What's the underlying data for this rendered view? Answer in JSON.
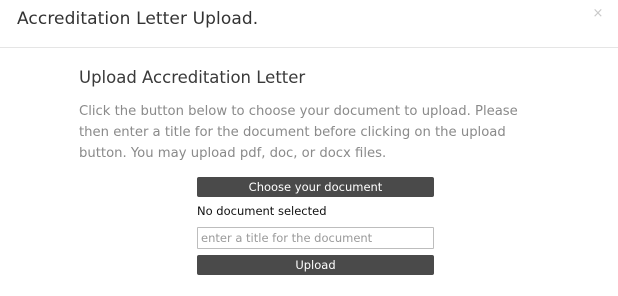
{
  "modal": {
    "title": "Accreditation Letter Upload.",
    "close_glyph": "×"
  },
  "content": {
    "heading": "Upload Accreditation Letter",
    "instructions": "Click the button below to choose your document to upload. Please then enter a title for the document before clicking on the upload button. You may upload pdf, doc, or docx files.",
    "choose_label": "Choose your document",
    "file_status": "No document selected",
    "title_input": {
      "value": "",
      "placeholder": "enter a title for the document"
    },
    "upload_label": "Upload"
  },
  "colors": {
    "button_bg": "#4a4a4a",
    "button_text": "#ffffff",
    "instructions_text": "#8a8a8a",
    "header_border": "#e5e5e5"
  },
  "icons": {
    "close": "close-icon"
  }
}
